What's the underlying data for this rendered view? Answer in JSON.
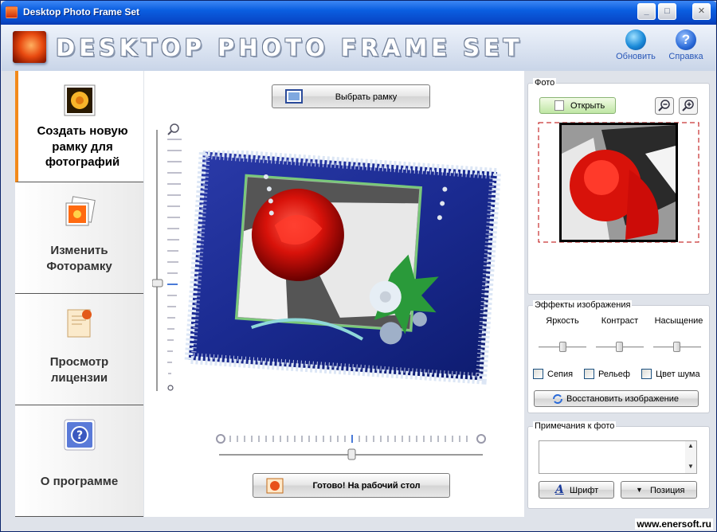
{
  "window": {
    "title": "Desktop Photo Frame Set",
    "minimize": "_",
    "maximize": "□",
    "close": "✕"
  },
  "header": {
    "brand": "DESKTOP PHOTO FRAME SET",
    "update_label": "Обновить",
    "help_label": "Справка"
  },
  "sidebar": {
    "items": [
      {
        "line1": "Создать новую",
        "line2": "рамку для",
        "line3": "фотографий"
      },
      {
        "line1": "Изменить",
        "line2": "Фоторамку"
      },
      {
        "line1": "Просмотр",
        "line2": "лицензии"
      },
      {
        "line1": "О программе"
      }
    ]
  },
  "main": {
    "choose_frame_label": "Выбрать рамку",
    "done_label": "Готово! На рабочий стол",
    "zoom_level": 0.5,
    "rotation_level": 0.5
  },
  "photo": {
    "legend": "Фото",
    "open_label": "Открыть"
  },
  "effects": {
    "legend": "Эффекты изображения",
    "brightness": "Яркость",
    "contrast": "Контраст",
    "saturation": "Насыщение",
    "brightness_level": 0.5,
    "contrast_level": 0.5,
    "saturation_level": 0.5,
    "sepia": "Сепия",
    "relief": "Рельеф",
    "noise": "Цвет шума",
    "restore_label": "Восстановить изображение"
  },
  "notes": {
    "legend": "Примечания к фото",
    "font_label": "Шрифт",
    "position_label": "Позиция"
  },
  "watermark": "www.enersoft.ru",
  "colors": {
    "accent": "#f28a1a",
    "titlebar": "#0a5ee0",
    "link": "#2857b8"
  }
}
